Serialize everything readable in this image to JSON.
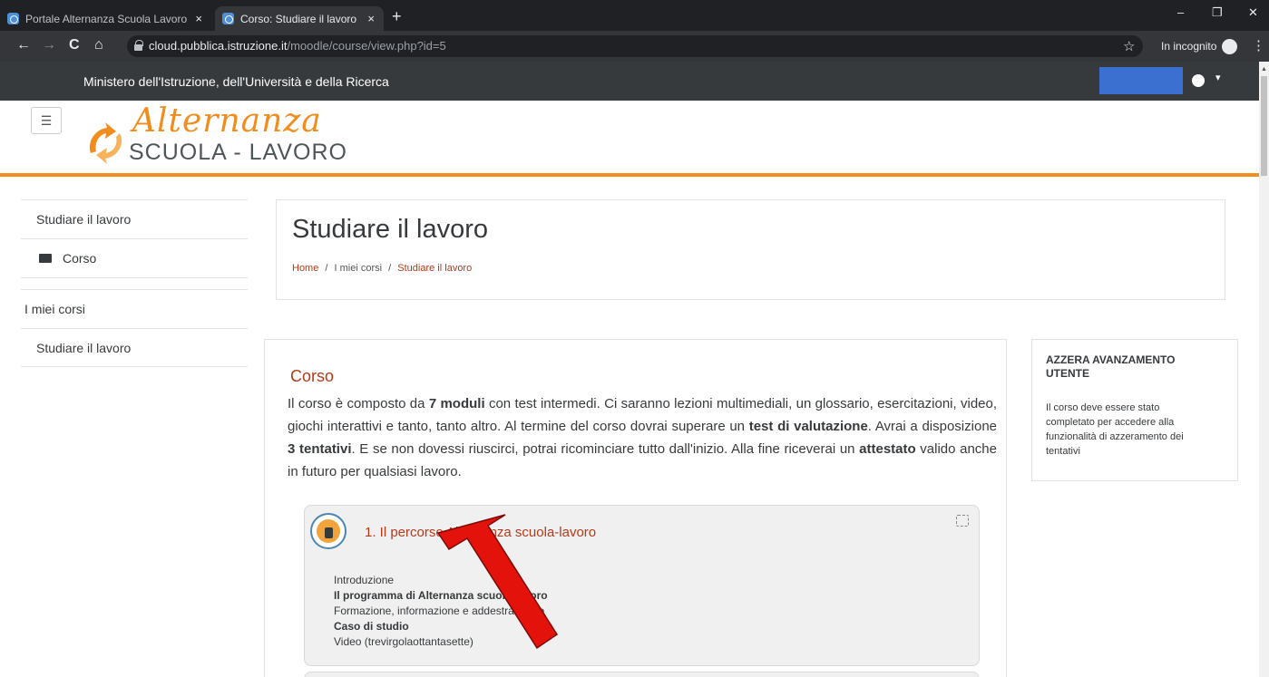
{
  "browser": {
    "tabs": [
      {
        "title": "Portale Alternanza Scuola Lavoro",
        "close": "×"
      },
      {
        "title": "Corso: Studiare il lavoro",
        "close": "×"
      }
    ],
    "new_tab": "+",
    "window_controls": {
      "minimize": "–",
      "restore": "❐",
      "close": "✕"
    },
    "nav": {
      "back": "←",
      "forward": "→",
      "reload": "C",
      "home": "⌂"
    },
    "url_host": "cloud.pubblica.istruzione.it",
    "url_path": "/moodle/course/view.php?id=5",
    "star": "☆",
    "incognito_label": "In incognito",
    "menu": "⋮"
  },
  "ministry_bar": {
    "text": "Ministero dell'Istruzione, dell'Università e della Ricerca",
    "user_caret": "▾"
  },
  "header": {
    "menu_toggle": "☰",
    "logo_line1": "Alternanza",
    "logo_line2": "SCUOLA - LAVORO"
  },
  "left_nav": {
    "course_title": "Studiare il lavoro",
    "section": "Corso",
    "my_courses": "I miei corsi",
    "my_course_item": "Studiare il lavoro"
  },
  "page_header": {
    "title": "Studiare il lavoro",
    "breadcrumb": {
      "home": "Home",
      "sep": "/",
      "my_courses": "I miei corsi",
      "current": "Studiare il lavoro"
    }
  },
  "main": {
    "section_title": "Corso",
    "description": {
      "p1": "Il corso è composto da ",
      "b1": "7 moduli",
      "p2": " con test intermedi. Ci saranno lezioni multimediali, un glossario, esercitazioni, video, giochi interattivi e tanto, tanto altro. Al termine del corso dovrai superare un ",
      "b2": "test di valutazione",
      "p3": ". Avrai a disposizione ",
      "b3": "3 tentativi",
      "p4": ". E se non dovessi riuscirci, potrai ricominciare tutto dall'inizio. Alla fine riceverai un ",
      "b4": "attestato",
      "p5": " valido anche in futuro per qualsiasi lavoro."
    },
    "module": {
      "title": "1. Il percorso Alternanza scuola-lavoro",
      "activities": [
        {
          "label": "Introduzione",
          "bold": false
        },
        {
          "label": "Il programma di Alternanza scuola-lavoro",
          "bold": true
        },
        {
          "label": "Formazione, informazione e addestramento",
          "bold": false
        },
        {
          "label": "Caso di studio",
          "bold": true
        },
        {
          "label": "Video (trevirgolaottantasette)",
          "bold": false
        }
      ]
    }
  },
  "right_block": {
    "title": "AZZERA AVANZAMENTO UTENTE",
    "text": "Il corso deve essere stato completato per accedere alla funzionalità di azzeramento dei tentativi"
  },
  "colors": {
    "accent_orange": "#f28c1c",
    "link_red": "#b33a1b",
    "ministry_bar": "#373a3c",
    "annotation_arrow": "#e3120b"
  }
}
